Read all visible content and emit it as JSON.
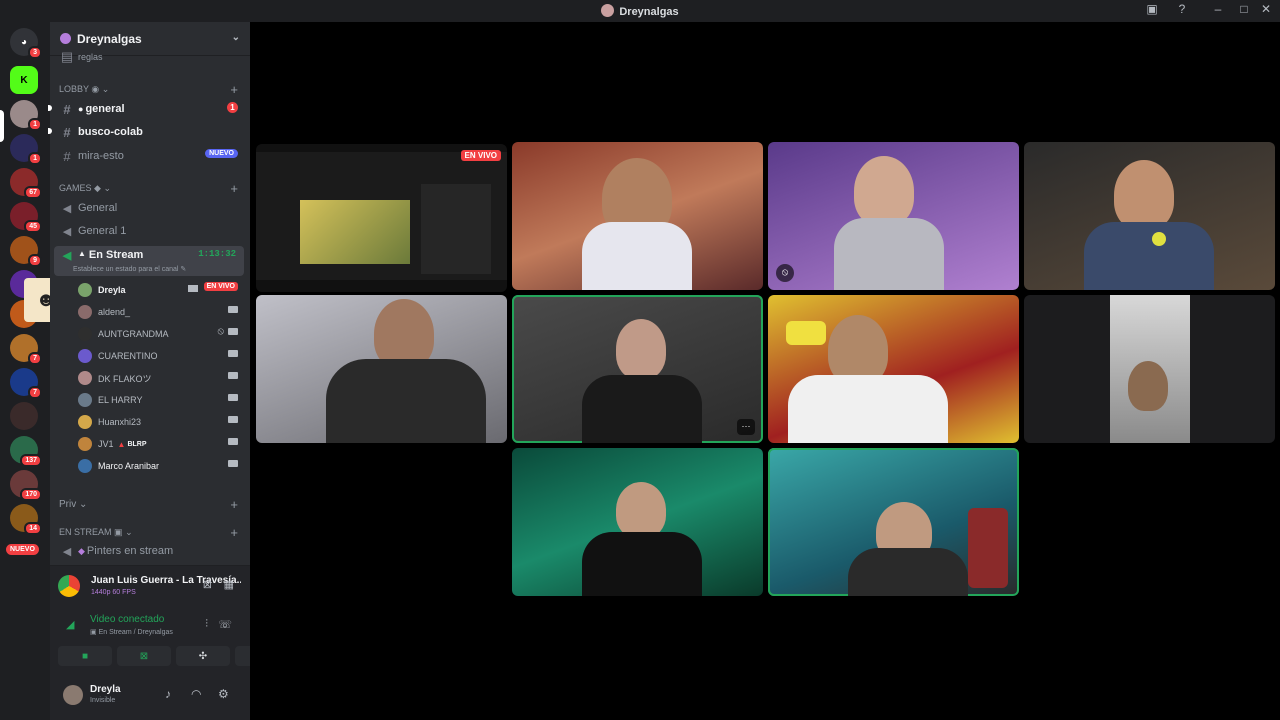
{
  "window": {
    "title": "Dreynalgas"
  },
  "server_rail": {
    "badges": [
      "3",
      "1",
      "1",
      "67",
      "45",
      "9",
      "7",
      "7",
      "137",
      "170",
      "14"
    ],
    "nuevo_label": "NUEVO",
    "icons": [
      "discord-logo-icon",
      "kick-server-icon",
      "community-server-icon",
      "server-icon",
      "server-icon",
      "server-icon",
      "server-icon",
      "server-icon",
      "server-icon",
      "server-icon",
      "server-icon",
      "server-icon",
      "server-icon",
      "server-icon",
      "server-icon"
    ]
  },
  "guild": {
    "name": "Dreynalgas"
  },
  "channels": {
    "top_partial": "reglas",
    "lobby_category": "LOBBY",
    "general": "general",
    "general_badge": "1",
    "busco_colab": "busco-colab",
    "mira_esto": "mira-esto",
    "mira_esto_tag": "NUEVO",
    "games_category": "GAMES",
    "voice_general": "General",
    "voice_general1": "General 1",
    "en_stream": "En Stream",
    "en_stream_timer": "1:13:32",
    "set_status": "Establece un estado para el canal",
    "priv_category": "Priv",
    "en_stream_category": "EN STREAM",
    "pinters": "Pinters en stream"
  },
  "members": [
    {
      "name": "Dreyla",
      "live": "EN VIVO",
      "color": "#7aa36b"
    },
    {
      "name": "aldend_",
      "color": "#8a6b6b"
    },
    {
      "name": "AUNTGRANDMA",
      "color": "#2e2e2e"
    },
    {
      "name": "CUARENTINO",
      "color": "#6b5acd"
    },
    {
      "name": "DK FLAKOツ",
      "color": "#b08a8a"
    },
    {
      "name": "EL HARRY",
      "color": "#6a7a8a"
    },
    {
      "name": "Huanxhi23",
      "color": "#d4a84a"
    },
    {
      "name": "JV1",
      "tag": "BLRP",
      "color": "#c0843c"
    },
    {
      "name": "Marco Aranibar",
      "color": "#3a6ea5"
    }
  ],
  "activity": {
    "title": "Juan Luis Guerra - La Travesía...",
    "quality": "1440p 60 FPS"
  },
  "voice": {
    "status": "Video conectado",
    "location": "En Stream / Dreynalgas"
  },
  "user": {
    "name": "Dreyla",
    "status": "Invisible"
  },
  "tiles": {
    "stream_live": "EN VIVO"
  },
  "colors": {
    "accent_green": "#23a55a",
    "danger_red": "#f23f42",
    "blurple": "#5865f2"
  }
}
